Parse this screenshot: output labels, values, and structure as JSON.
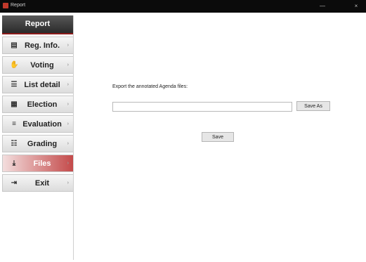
{
  "window": {
    "title": "Report",
    "minimize_glyph": "—",
    "maximize_glyph": "",
    "close_glyph": "×"
  },
  "sidebar": {
    "header": "Report",
    "items": [
      {
        "label": "Reg. Info.",
        "icon": "id-card-icon",
        "glyph": "▤"
      },
      {
        "label": "Voting",
        "icon": "hand-icon",
        "glyph": "✋"
      },
      {
        "label": "List detail",
        "icon": "list-icon",
        "glyph": "☰"
      },
      {
        "label": "Election",
        "icon": "chart-icon",
        "glyph": "▦"
      },
      {
        "label": "Evaluation",
        "icon": "evaluation-icon",
        "glyph": "≡"
      },
      {
        "label": "Grading",
        "icon": "grading-icon",
        "glyph": "☷"
      },
      {
        "label": "Files",
        "icon": "download-icon",
        "glyph": "⤓",
        "active": true
      },
      {
        "label": "Exit",
        "icon": "exit-icon",
        "glyph": "⇥"
      }
    ],
    "chevron": "›"
  },
  "main": {
    "export_label": "Export the annotated Agenda files:",
    "path_value": "",
    "save_as_label": "Save As",
    "save_label": "Save"
  },
  "colors": {
    "active": "#c44a4a",
    "titlebar": "#0b0b0b",
    "header": "#2a2a2a"
  }
}
